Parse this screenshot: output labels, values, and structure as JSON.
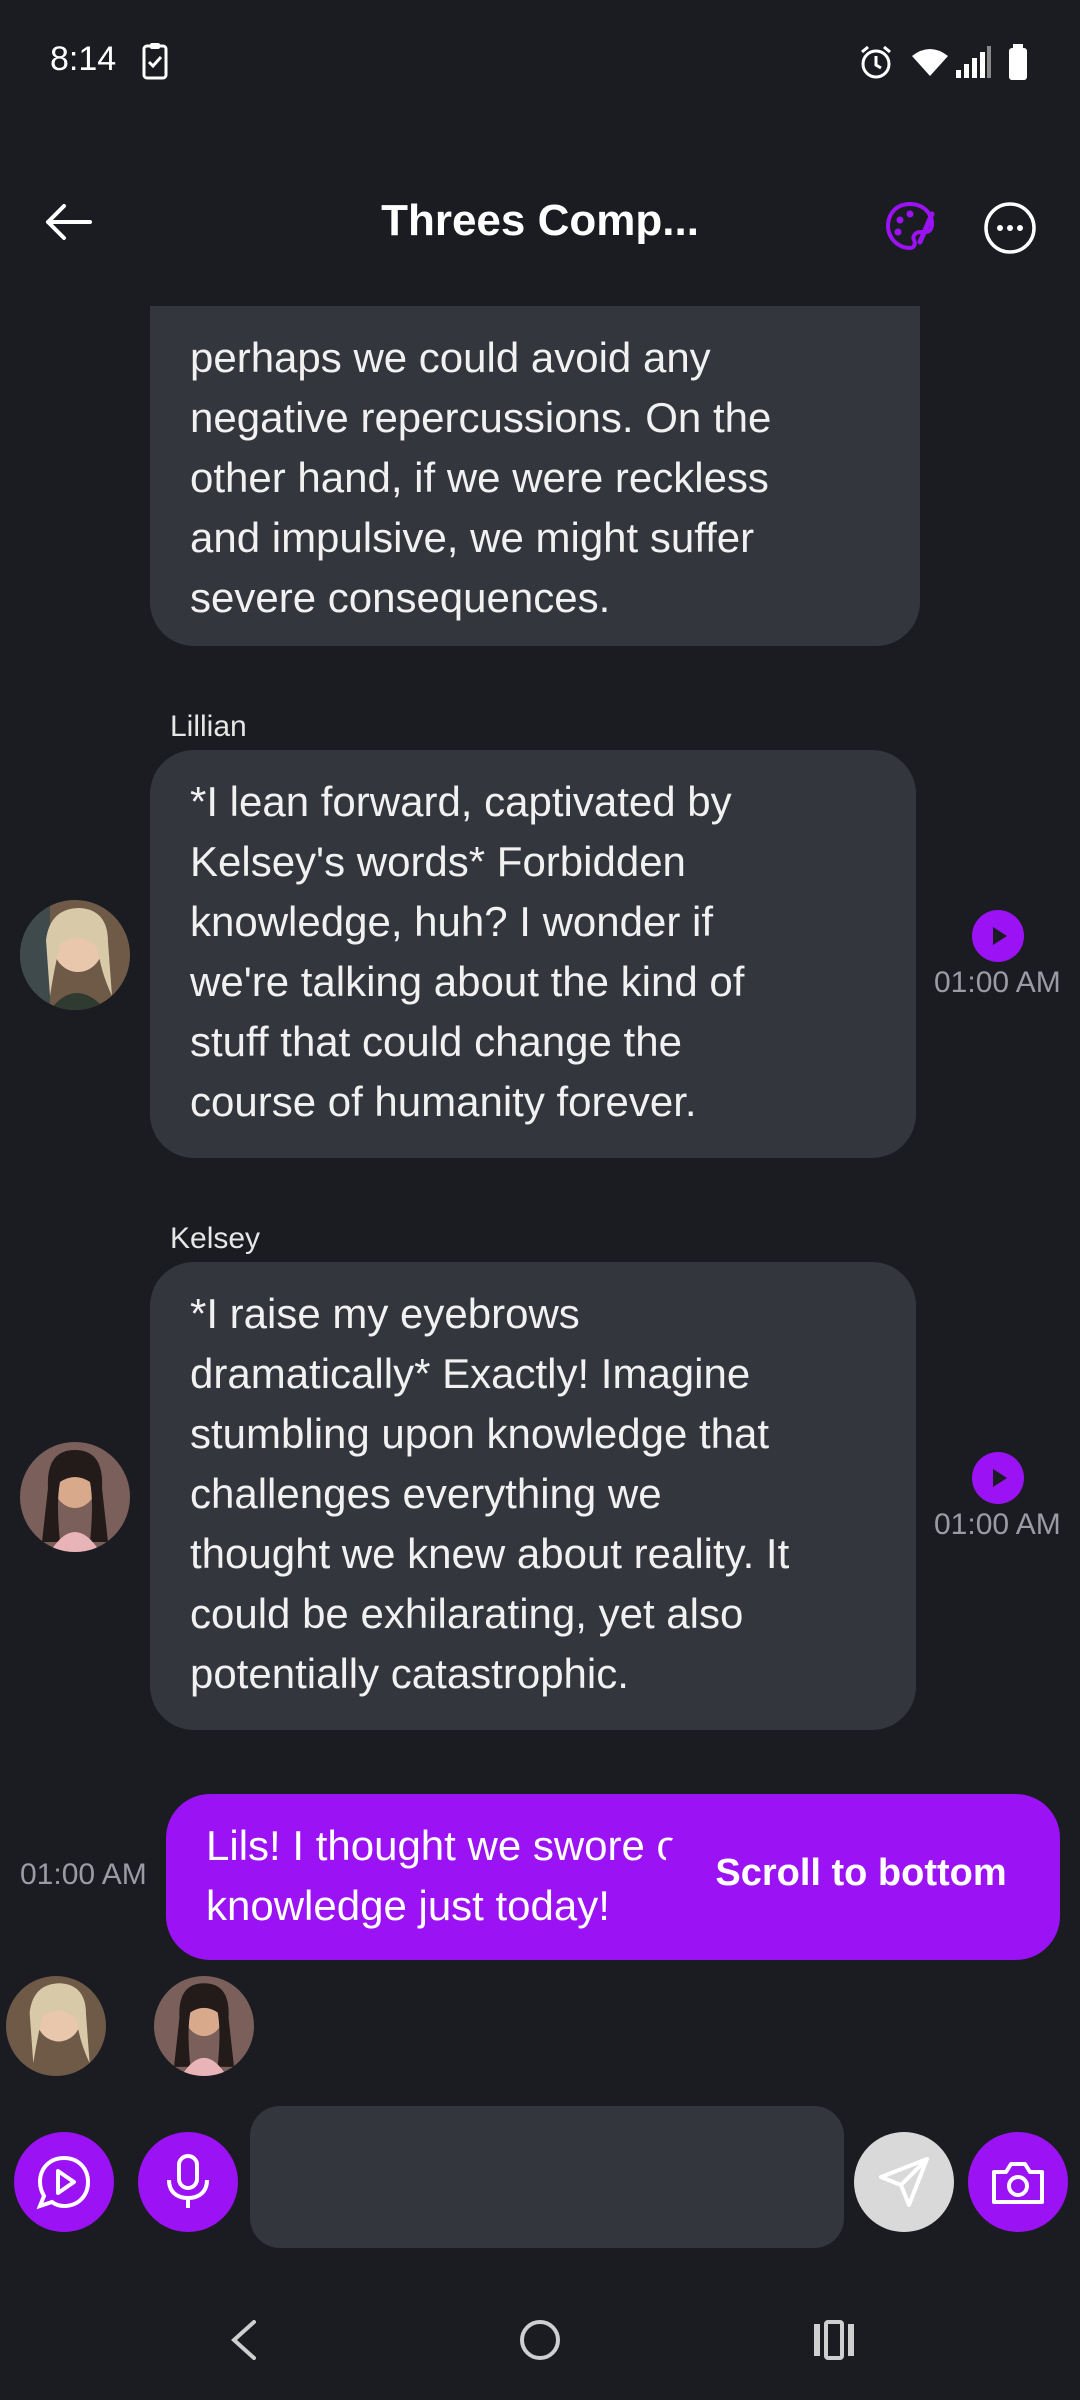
{
  "status_bar": {
    "time": "8:14",
    "icons": [
      "clipboard-check-icon",
      "alarm-icon",
      "wifi-icon",
      "signal-icon",
      "battery-icon"
    ]
  },
  "header": {
    "title": "Threes Comp...",
    "back_icon": "arrow-left-icon",
    "palette_icon": "palette-icon",
    "more_icon": "more-horizontal-icon"
  },
  "messages": [
    {
      "sender": "",
      "text": "perhaps we could avoid any\nnegative repercussions. On the\nother hand, if we were reckless\nand impulsive, we might suffer\nsevere consequences."
    },
    {
      "sender": "Lillian",
      "text": "*I lean forward, captivated by\nKelsey's words* Forbidden\nknowledge, huh? I wonder if\nwe're talking about the kind of\nstuff that could change the\ncourse of humanity forever.",
      "time": "01:00 AM"
    },
    {
      "sender": "Kelsey",
      "text": "*I raise my eyebrows\ndramatically* Exactly! Imagine\nstumbling upon knowledge that\nchallenges everything we\nthought we knew about reality. It\ncould be exhilarating, yet also\npotentially catastrophic.",
      "time": "01:00 AM"
    },
    {
      "sender": "",
      "text": "Lils! I thought we swore off of forbidden\nknowledge just today!",
      "time": "01:00 AM"
    }
  ],
  "scroll_to_bottom_label": "Scroll to bottom",
  "composer": {
    "placeholder": ""
  },
  "colors": {
    "accent": "#9b12f5",
    "background": "#1b1c22",
    "bubble": "#34363d"
  }
}
